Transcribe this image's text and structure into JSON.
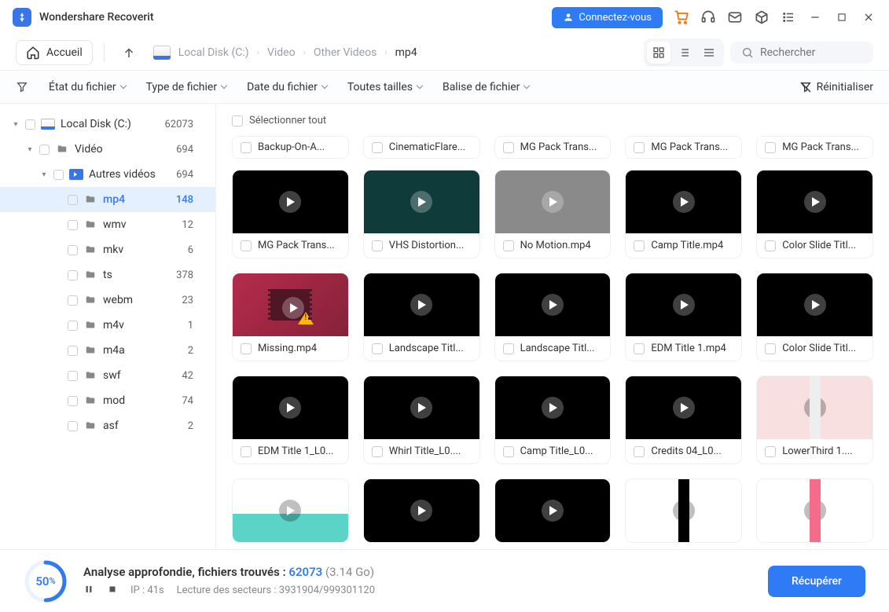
{
  "app": {
    "title": "Wondershare Recoverit"
  },
  "titlebar": {
    "connect": "Connectez-vous"
  },
  "toolbar": {
    "home": "Accueil",
    "breadcrumb": [
      "Local Disk (C:)",
      "Video",
      "Other Videos",
      "mp4"
    ],
    "search_placeholder": "Rechercher"
  },
  "filters": {
    "file_state": "État du fichier",
    "file_type": "Type de fichier",
    "file_date": "Date du fichier",
    "file_size": "Toutes tailles",
    "file_tag": "Balise de fichier",
    "reset": "Réinitialiser"
  },
  "tree": [
    {
      "label": "Local Disk (C:)",
      "count": "62073",
      "depth": 0,
      "expandable": true,
      "icon": "disk",
      "expanded": true
    },
    {
      "label": "Vidéo",
      "count": "694",
      "depth": 1,
      "expandable": true,
      "icon": "folder",
      "expanded": true
    },
    {
      "label": "Autres vidéos",
      "count": "694",
      "depth": 2,
      "expandable": true,
      "icon": "video",
      "expanded": true
    },
    {
      "label": "mp4",
      "count": "148",
      "depth": 3,
      "icon": "folder",
      "selected": true
    },
    {
      "label": "wmv",
      "count": "12",
      "depth": 3,
      "icon": "folder"
    },
    {
      "label": "mkv",
      "count": "6",
      "depth": 3,
      "icon": "folder"
    },
    {
      "label": "ts",
      "count": "378",
      "depth": 3,
      "icon": "folder"
    },
    {
      "label": "webm",
      "count": "23",
      "depth": 3,
      "icon": "folder"
    },
    {
      "label": "m4v",
      "count": "1",
      "depth": 3,
      "icon": "folder"
    },
    {
      "label": "m4a",
      "count": "2",
      "depth": 3,
      "icon": "folder"
    },
    {
      "label": "swf",
      "count": "42",
      "depth": 3,
      "icon": "folder"
    },
    {
      "label": "mod",
      "count": "74",
      "depth": 3,
      "icon": "folder"
    },
    {
      "label": "asf",
      "count": "2",
      "depth": 3,
      "icon": "folder"
    }
  ],
  "content": {
    "select_all": "Sélectionner tout",
    "stubs": [
      "Backup-On-A...",
      "CinematicFlare...",
      "MG Pack Trans...",
      "MG Pack Trans...",
      "MG Pack Trans..."
    ],
    "cards": [
      {
        "name": "MG Pack Trans...",
        "thumb": "black"
      },
      {
        "name": "VHS Distortion...",
        "thumb": "teal"
      },
      {
        "name": "No Motion.mp4",
        "thumb": "grey"
      },
      {
        "name": "Camp Title.mp4",
        "thumb": "black"
      },
      {
        "name": "Color Slide Titl...",
        "thumb": "black"
      },
      {
        "name": "Missing.mp4",
        "thumb": "red",
        "special": "missing"
      },
      {
        "name": "Landscape Titl...",
        "thumb": "black"
      },
      {
        "name": "Landscape Titl...",
        "thumb": "black"
      },
      {
        "name": "EDM Title 1.mp4",
        "thumb": "black"
      },
      {
        "name": "Color Slide Titl...",
        "thumb": "black"
      },
      {
        "name": "EDM Title 1_L0...",
        "thumb": "black"
      },
      {
        "name": "Whirl Title_L0....",
        "thumb": "black"
      },
      {
        "name": "Camp Title_L0...",
        "thumb": "black"
      },
      {
        "name": "Credits 04_L0...",
        "thumb": "black"
      },
      {
        "name": "LowerThird 1....",
        "thumb": "light",
        "stripe": "#eee"
      },
      {
        "name": "",
        "thumb": "teal2",
        "half": "#5bd3c7"
      },
      {
        "name": "",
        "thumb": "black"
      },
      {
        "name": "",
        "thumb": "black"
      },
      {
        "name": "",
        "thumb": "white",
        "stripe": "#000"
      },
      {
        "name": "",
        "thumb": "white",
        "stripe": "#f56b8a"
      }
    ]
  },
  "bottom": {
    "percent": "50",
    "line1_pre": "Analyse approfondie, fichiers trouvés : ",
    "count": "62073",
    "size": "(3.14 Go)",
    "ip": "IP : 41s",
    "sectors": "Lecture des secteurs : 3931904/999301120",
    "recover": "Récupérer"
  }
}
